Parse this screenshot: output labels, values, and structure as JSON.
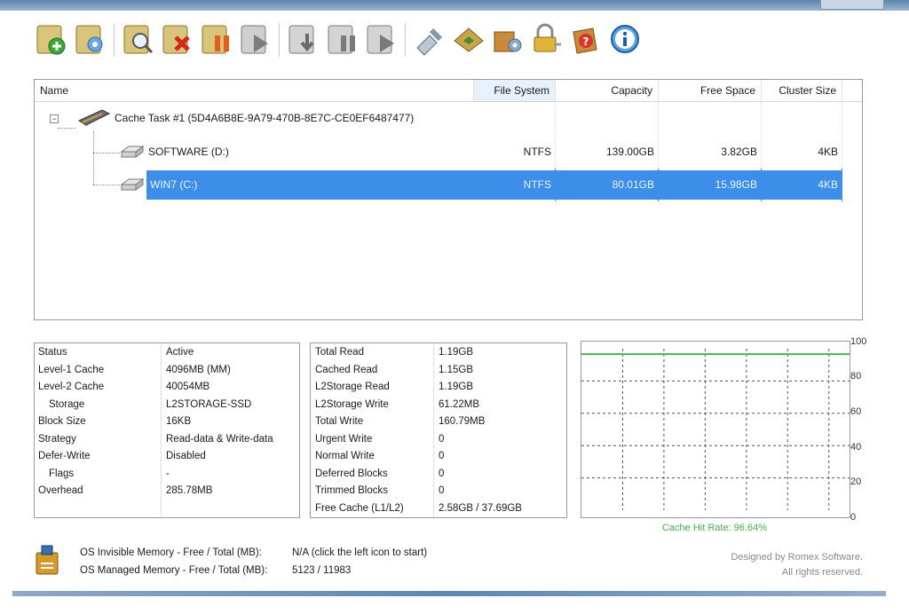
{
  "grid": {
    "columns": [
      "Name",
      "File System",
      "Capacity",
      "Free Space",
      "Cluster Size"
    ],
    "task": "Cache Task #1 (5D4A6B8E-9A79-470B-8E7C-CE0EF6487477)",
    "rows": [
      {
        "name": "SOFTWARE (D:)",
        "fs": "NTFS",
        "capacity": "139.00GB",
        "free": "3.82GB",
        "cluster": "4KB"
      },
      {
        "name": "WIN7 (C:)",
        "fs": "NTFS",
        "capacity": "80.01GB",
        "free": "15.98GB",
        "cluster": "4KB"
      }
    ]
  },
  "status_panel": {
    "labels": [
      "Status",
      "Level-1 Cache",
      "Level-2 Cache",
      "Storage",
      "Block Size",
      "Strategy",
      "Defer-Write",
      "Flags",
      "Overhead"
    ],
    "values": [
      "Active",
      "4096MB (MM)",
      "40054MB",
      "L2STORAGE-SSD",
      "16KB",
      "Read-data & Write-data",
      "Disabled",
      "-",
      "285.78MB"
    ]
  },
  "stats_panel": {
    "labels": [
      "Total Read",
      "Cached Read",
      "L2Storage Read",
      "L2Storage Write",
      "Total Write",
      "Urgent Write",
      "Normal Write",
      "Deferred Blocks",
      "Trimmed Blocks",
      "Free Cache (L1/L2)"
    ],
    "values": [
      "1.19GB",
      "1.15GB",
      "1.19GB",
      "61.22MB",
      "160.79MB",
      "0",
      "0",
      "0",
      "0",
      "2.58GB / 37.69GB"
    ]
  },
  "chart_data": {
    "type": "line",
    "yticks": [
      "100",
      "80",
      "60",
      "40",
      "20",
      "0"
    ],
    "ylim": [
      0,
      100
    ],
    "series": [
      {
        "values": [
          96.64,
          96.64,
          96.64,
          96.64,
          96.64,
          96.64,
          96.64,
          96.64
        ]
      }
    ],
    "caption": "Cache Hit Rate: 96.64%"
  },
  "memory": {
    "invisible_label": "OS Invisible Memory - Free / Total (MB):",
    "invisible_value": "N/A (click the left icon to start)",
    "managed_label": "OS Managed Memory - Free / Total (MB):",
    "managed_value": "5123 / 11983"
  },
  "credit": {
    "line1": "Designed by Romex Software.",
    "line2": "All rights reserved."
  },
  "colors": {
    "selection": "#3d8ee8",
    "chart_line": "#49b449",
    "title_bar": "#5d84ad"
  },
  "toolbar_icons": [
    "add-task-icon",
    "configure-task-icon",
    "view-task-icon",
    "delete-task-icon",
    "pause-task-icon",
    "resume-task-icon",
    "flush-disk-icon",
    "pause-disk-icon",
    "resume-disk-icon",
    "tools-icon",
    "license-icon",
    "package-icon",
    "lock-icon",
    "help-icon",
    "about-icon"
  ]
}
